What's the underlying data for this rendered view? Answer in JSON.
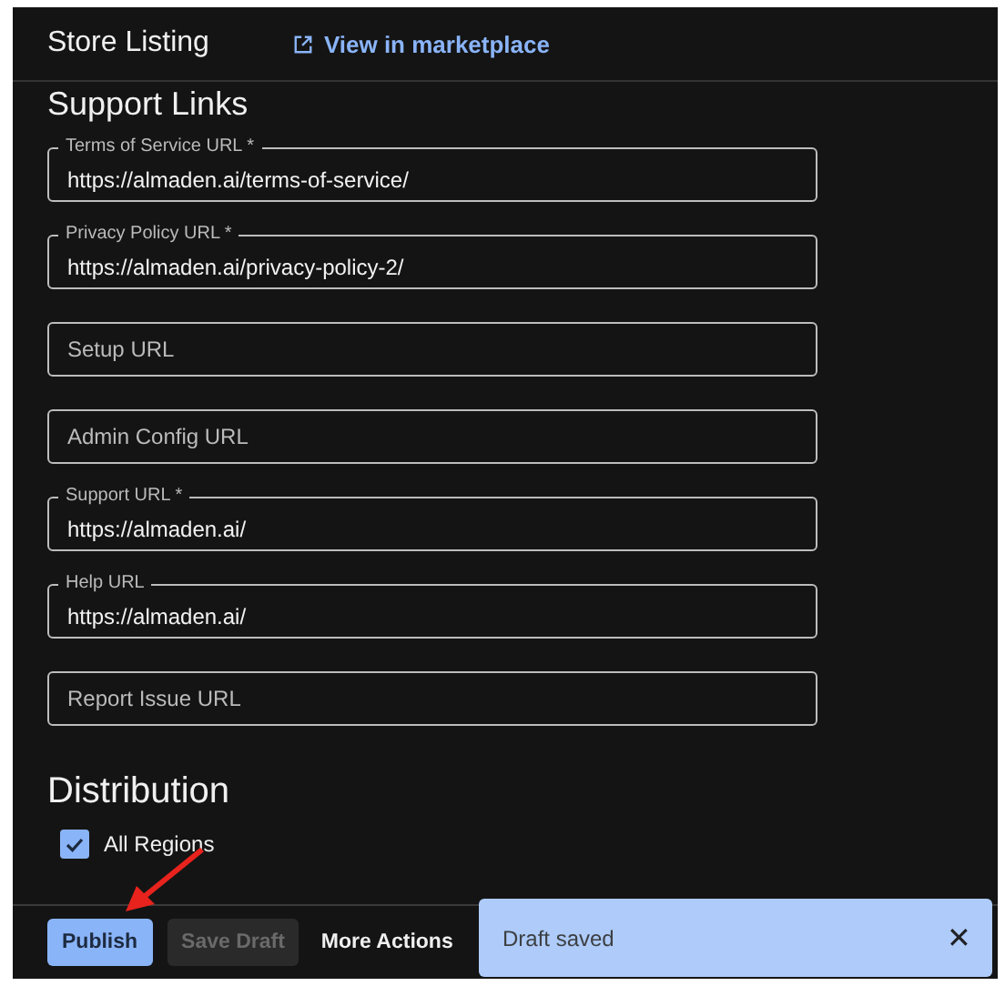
{
  "header": {
    "title": "Store Listing",
    "link": "View in marketplace"
  },
  "support_links": {
    "heading": "Support Links",
    "fields": [
      {
        "label": "Terms of Service URL *",
        "value": "https://almaden.ai/terms-of-service/"
      },
      {
        "label": "Privacy Policy URL *",
        "value": "https://almaden.ai/privacy-policy-2/"
      },
      {
        "placeholder": "Setup URL"
      },
      {
        "placeholder": "Admin Config URL"
      },
      {
        "label": "Support URL *",
        "value": "https://almaden.ai/"
      },
      {
        "label": "Help URL",
        "value": "https://almaden.ai/"
      },
      {
        "placeholder": "Report Issue URL"
      }
    ]
  },
  "distribution": {
    "heading": "Distribution",
    "checkbox": {
      "label": "All Regions",
      "checked": true
    }
  },
  "footer": {
    "buttons": [
      {
        "label": "Publish",
        "kind": "primary"
      },
      {
        "label": "Save Draft",
        "kind": "disabled"
      },
      {
        "label": "More Actions",
        "kind": "text"
      }
    ]
  },
  "toast": {
    "message": "Draft saved",
    "close": "✕"
  }
}
